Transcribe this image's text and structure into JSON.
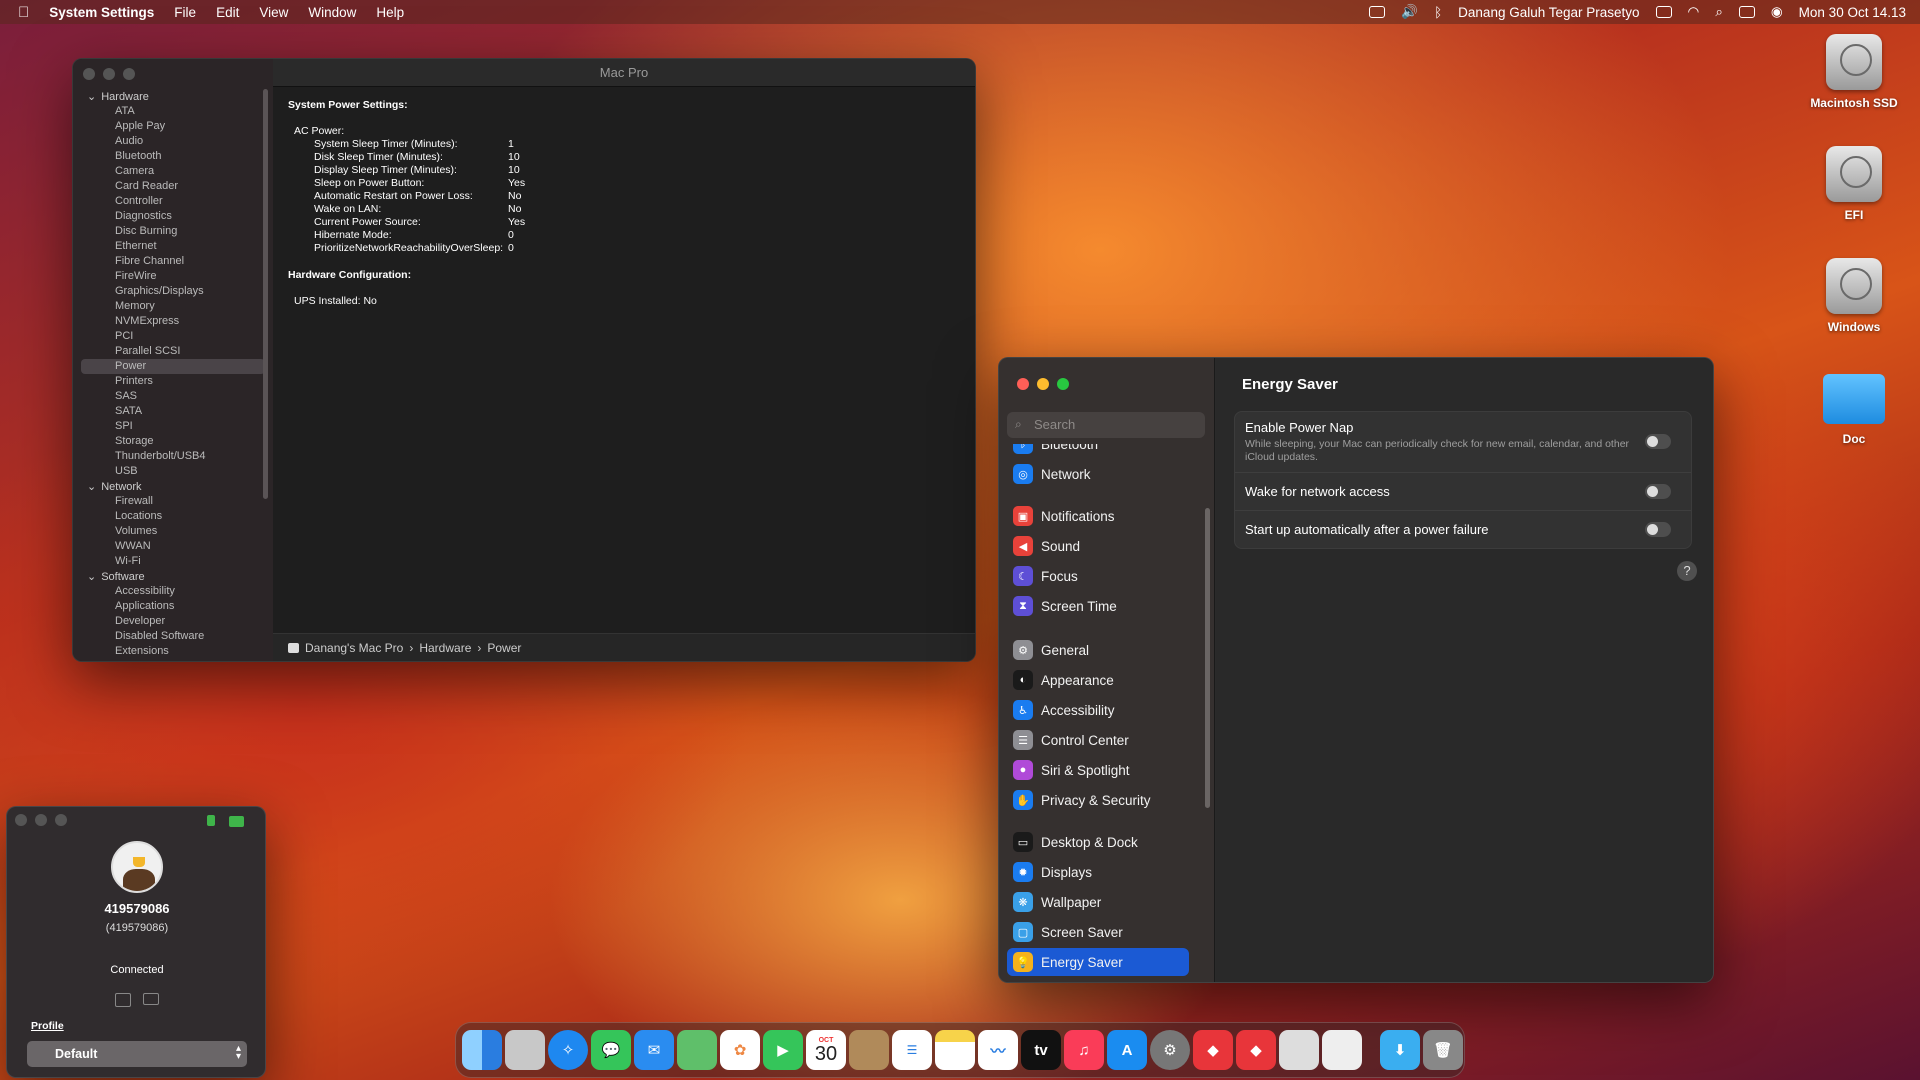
{
  "menubar": {
    "app": "System Settings",
    "items": [
      "File",
      "Edit",
      "View",
      "Window",
      "Help"
    ],
    "user": "Danang Galuh Tegar Prasetyo",
    "clock": "Mon 30 Oct  14.13"
  },
  "sysinfo": {
    "title": "Mac Pro",
    "sidebar": [
      {
        "section": "Hardware",
        "items": [
          "ATA",
          "Apple Pay",
          "Audio",
          "Bluetooth",
          "Camera",
          "Card Reader",
          "Controller",
          "Diagnostics",
          "Disc Burning",
          "Ethernet",
          "Fibre Channel",
          "FireWire",
          "Graphics/Displays",
          "Memory",
          "NVMExpress",
          "PCI",
          "Parallel SCSI",
          "Power",
          "Printers",
          "SAS",
          "SATA",
          "SPI",
          "Storage",
          "Thunderbolt/USB4",
          "USB"
        ]
      },
      {
        "section": "Network",
        "items": [
          "Firewall",
          "Locations",
          "Volumes",
          "WWAN",
          "Wi-Fi"
        ]
      },
      {
        "section": "Software",
        "items": [
          "Accessibility",
          "Applications",
          "Developer",
          "Disabled Software",
          "Extensions"
        ]
      }
    ],
    "selected": "Power",
    "heading1": "System Power Settings:",
    "ac_label": "AC Power:",
    "settings": [
      [
        "System Sleep Timer (Minutes):",
        "1"
      ],
      [
        "Disk Sleep Timer (Minutes):",
        "10"
      ],
      [
        "Display Sleep Timer (Minutes):",
        "10"
      ],
      [
        "Sleep on Power Button:",
        "Yes"
      ],
      [
        "Automatic Restart on Power Loss:",
        "No"
      ],
      [
        "Wake on LAN:",
        "No"
      ],
      [
        "Current Power Source:",
        "Yes"
      ],
      [
        "Hibernate Mode:",
        "0"
      ],
      [
        "PrioritizeNetworkReachabilityOverSleep:",
        "0"
      ]
    ],
    "heading2": "Hardware Configuration:",
    "ups": "UPS Installed:  No",
    "path": [
      "Danang's Mac Pro",
      "Hardware",
      "Power"
    ]
  },
  "settings": {
    "search_placeholder": "Search",
    "nav": [
      {
        "label": "Bluetooth",
        "color": "#1a7cf0",
        "icon": "ᛒ"
      },
      {
        "label": "Network",
        "color": "#1a7cf0",
        "icon": "◎"
      },
      {
        "label": "Notifications",
        "color": "#e8423a",
        "icon": "▣"
      },
      {
        "label": "Sound",
        "color": "#e8423a",
        "icon": "◀"
      },
      {
        "label": "Focus",
        "color": "#5e4fd6",
        "icon": "☾"
      },
      {
        "label": "Screen Time",
        "color": "#5e4fd6",
        "icon": "⧗"
      },
      {
        "label": "General",
        "color": "#8e8e93",
        "icon": "⚙"
      },
      {
        "label": "Appearance",
        "color": "#1a1a1a",
        "icon": "◐"
      },
      {
        "label": "Accessibility",
        "color": "#1a7cf0",
        "icon": "♿"
      },
      {
        "label": "Control Center",
        "color": "#8e8e93",
        "icon": "☰"
      },
      {
        "label": "Siri & Spotlight",
        "color": "#b04ad8",
        "icon": "●"
      },
      {
        "label": "Privacy & Security",
        "color": "#1a7cf0",
        "icon": "✋"
      },
      {
        "label": "Desktop & Dock",
        "color": "#1a1a1a",
        "icon": "▭"
      },
      {
        "label": "Displays",
        "color": "#1a7cf0",
        "icon": "✹"
      },
      {
        "label": "Wallpaper",
        "color": "#3aa0e8",
        "icon": "❋"
      },
      {
        "label": "Screen Saver",
        "color": "#3aa0e8",
        "icon": "▢"
      },
      {
        "label": "Energy Saver",
        "color": "#f5b21c",
        "icon": "💡"
      }
    ],
    "title": "Energy Saver",
    "rows": [
      {
        "label": "Enable Power Nap",
        "desc": "While sleeping, your Mac can periodically check for new email, calendar, and other iCloud updates.",
        "on": false
      },
      {
        "label": "Wake for network access",
        "desc": "",
        "on": false
      },
      {
        "label": "Start up automatically after a power failure",
        "desc": "",
        "on": false
      }
    ],
    "help": "?"
  },
  "teamviewer": {
    "id": "419579086",
    "id_paren": "(419579086)",
    "status": "Connected",
    "profile_label": "Profile",
    "profile_value": "Default"
  },
  "desktop": [
    "Macintosh SSD",
    "EFI",
    "Windows",
    "Doc"
  ],
  "dock": {
    "calendar_month": "OCT",
    "calendar_day": "30"
  }
}
